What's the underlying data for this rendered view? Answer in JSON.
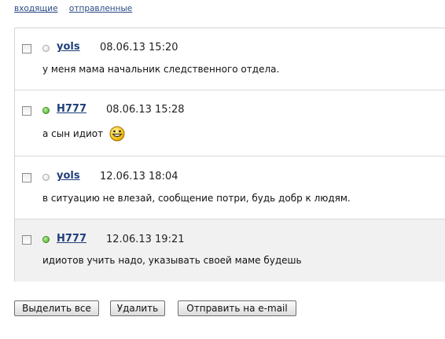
{
  "tabs": {
    "inbox": "входящие",
    "sent": "отправленные"
  },
  "messages": [
    {
      "author": "yols",
      "date": "08.06.13 15:20",
      "status": "offline",
      "text": "у меня мама начальник следственного отдела.",
      "icon": "grin-smiley-icon"
    },
    {
      "author": "H777",
      "date": "08.06.13 15:28",
      "status": "online",
      "text": "а сын идиот",
      "icon": "grin-smiley-icon"
    },
    {
      "author": "yols",
      "date": "12.06.13 18:04",
      "status": "offline",
      "text": "в ситуацию не влезай, сообщение потри, будь добр к людям."
    },
    {
      "author": "H777",
      "date": "12.06.13 19:21",
      "status": "online",
      "text": "идиотов учить надо, указывать своей маме будешь"
    }
  ],
  "buttons": {
    "select_all": "Выделить все",
    "delete": "Удалить",
    "send_email": "Отправить на e-mail"
  },
  "colors": {
    "link": "#1f3f7a",
    "online": "#45a320",
    "offline": "#d7d7d7",
    "highlight_row": "#f1f1f1"
  }
}
